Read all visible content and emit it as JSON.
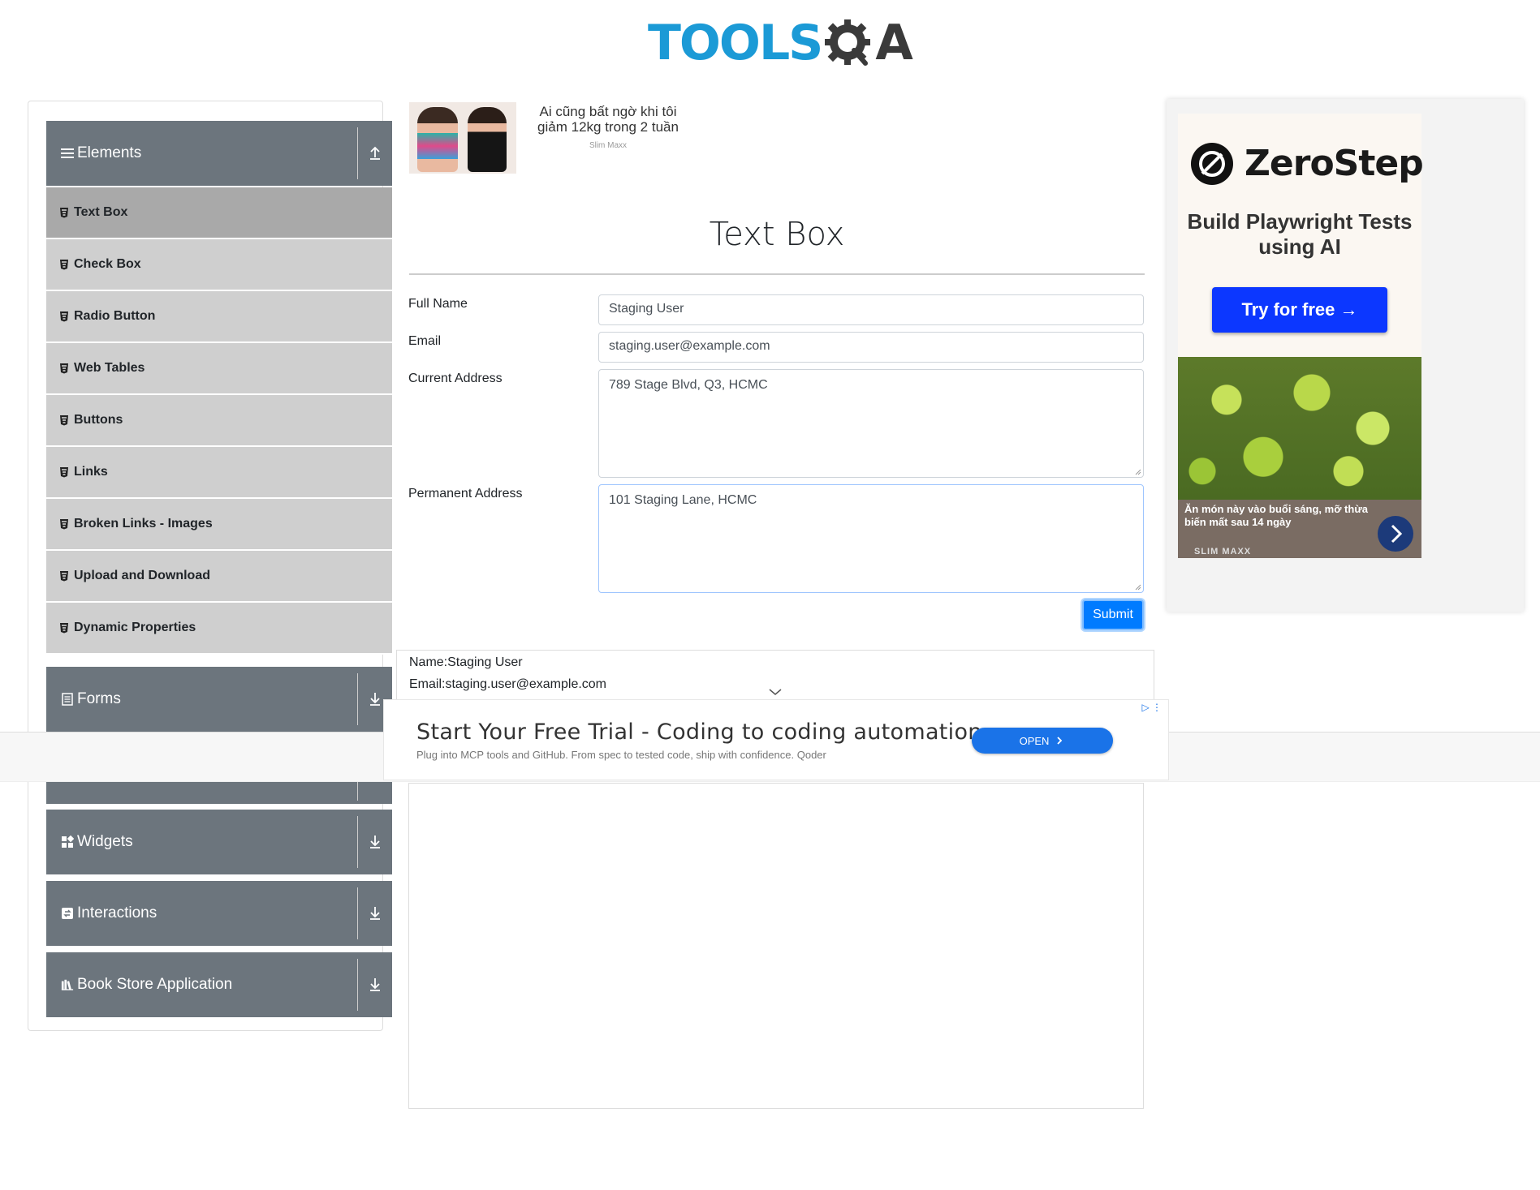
{
  "header": {
    "logo_tools": "TOOLS",
    "logo_a": "A"
  },
  "sidebar": {
    "groups": [
      {
        "label": "Elements",
        "icon": "list-icon",
        "expanded": true
      },
      {
        "label": "Forms",
        "icon": "form-icon",
        "expanded": false
      },
      {
        "label": "Widgets",
        "icon": "widgets-icon",
        "expanded": false
      },
      {
        "label": "Interactions",
        "icon": "interactions-icon",
        "expanded": false
      },
      {
        "label": "Book Store Application",
        "icon": "book-icon",
        "expanded": false
      }
    ],
    "items": [
      {
        "label": "Text Box",
        "active": true
      },
      {
        "label": "Check Box"
      },
      {
        "label": "Radio Button"
      },
      {
        "label": "Web Tables"
      },
      {
        "label": "Buttons"
      },
      {
        "label": "Links"
      },
      {
        "label": "Broken Links - Images"
      },
      {
        "label": "Upload and Download"
      },
      {
        "label": "Dynamic Properties"
      }
    ]
  },
  "ad_top": {
    "text": "Ai cũng bất ngờ khi tôi giảm 12kg trong 2 tuần",
    "brand": "Slim Maxx"
  },
  "main": {
    "title": "Text Box",
    "form": {
      "full_name_label": "Full Name",
      "full_name_value": "Staging User",
      "email_label": "Email",
      "email_value": "staging.user@example.com",
      "current_address_label": "Current Address",
      "current_address_value": "789 Stage Blvd, Q3, HCMC",
      "permanent_address_label": "Permanent Address",
      "permanent_address_value": "101 Staging Lane, HCMC",
      "submit_label": "Submit"
    },
    "output": {
      "name": "Name:Staging User",
      "email": "Email:staging.user@example.com"
    }
  },
  "ad_bottom": {
    "headline": "Start Your Free Trial - Coding to coding automation",
    "subline": "Plug into MCP tools and GitHub. From spec to tested code, ship with confidence. Qoder",
    "button": "OPEN"
  },
  "ad_right": {
    "brand": "ZeroStep",
    "tagline": "Build Playwright Tests using AI",
    "button": "Try for free →",
    "food_caption": "Ăn món này vào buổi sáng, mỡ thừa biến mất sau 14 ngày",
    "food_brand": "SLIM MAXX"
  },
  "colors": {
    "accent": "#007bff",
    "group_header": "#6c757d",
    "menu_item": "#cfcfcf",
    "menu_active": "#a9a9a9"
  }
}
